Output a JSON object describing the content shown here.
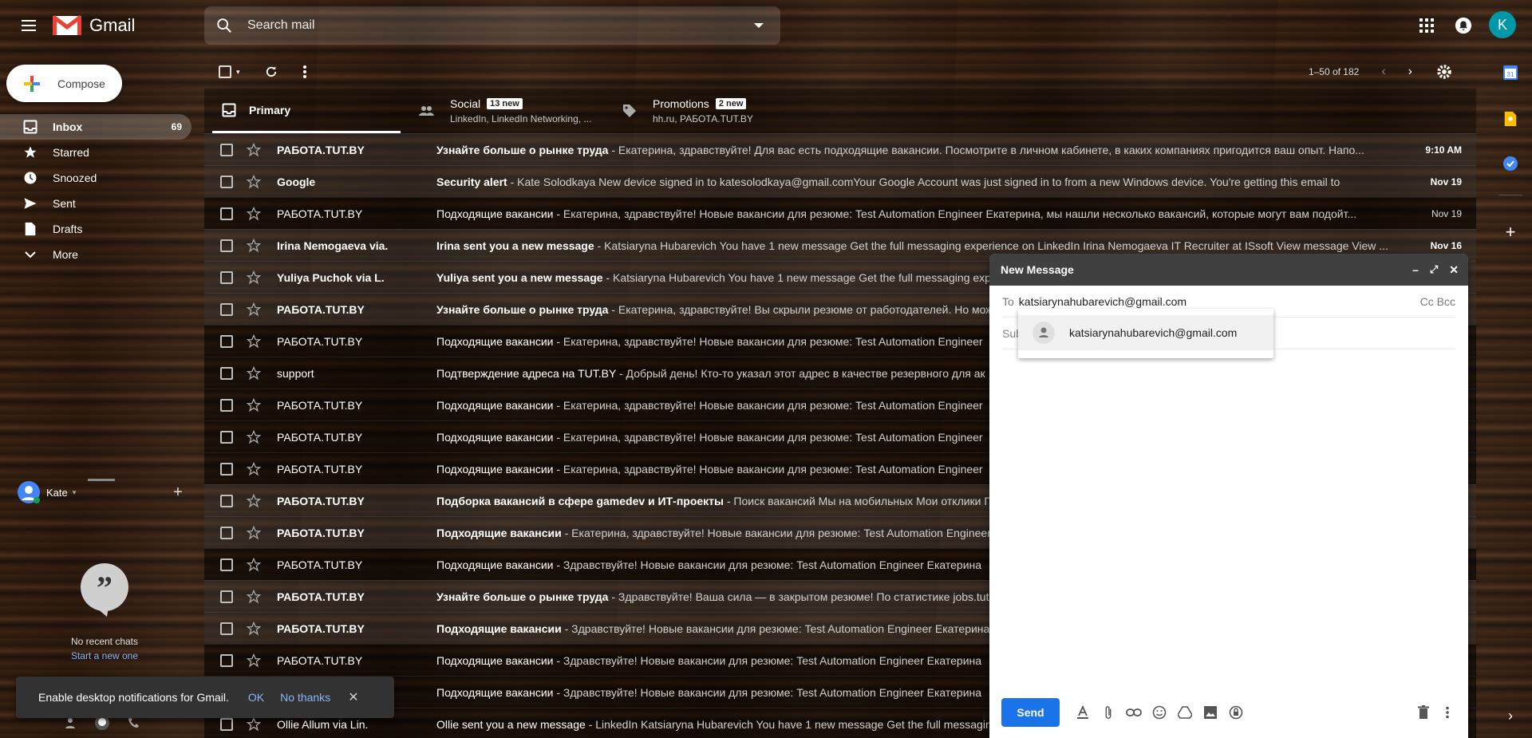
{
  "app": {
    "name": "Gmail",
    "logo_icon": "gmail-logo"
  },
  "search": {
    "placeholder": "Search mail"
  },
  "account": {
    "initial": "K",
    "color": "#0097a7"
  },
  "compose_label": "Compose",
  "nav": [
    {
      "label": "Inbox",
      "count": "69",
      "icon": "inbox-icon",
      "active": true
    },
    {
      "label": "Starred",
      "count": "",
      "icon": "star-icon"
    },
    {
      "label": "Snoozed",
      "count": "",
      "icon": "clock-icon"
    },
    {
      "label": "Sent",
      "count": "",
      "icon": "send-icon"
    },
    {
      "label": "Drafts",
      "count": "",
      "icon": "draft-icon"
    },
    {
      "label": "More",
      "count": "",
      "icon": "chevron-down-icon"
    }
  ],
  "hangouts": {
    "user": "Kate",
    "no_chats": "No recent chats",
    "start_new": "Start a new one"
  },
  "toolbar": {
    "pagination": "1–50 of 182"
  },
  "tabs": [
    {
      "label": "Primary",
      "sub": "",
      "badge": "",
      "icon": "inbox-icon",
      "active": true
    },
    {
      "label": "Social",
      "sub": "LinkedIn, LinkedIn Networking, ...",
      "badge": "13 new",
      "icon": "people-icon"
    },
    {
      "label": "Promotions",
      "sub": "hh.ru, РАБОТА.TUT.BY",
      "badge": "2 new",
      "icon": "tag-icon"
    }
  ],
  "emails": [
    {
      "sender": "РАБОТА.TUT.BY",
      "subject": "Узнайте больше о рынке труда",
      "snippet": " - Екатерина, здравствуйте! Для вас есть подходящие вакансии. Посмотрите в личном кабинете, в каких компаниях пригодится ваш опыт. Напо...",
      "date": "9:10 AM",
      "unread": true
    },
    {
      "sender": "Google",
      "subject": "Security alert",
      "snippet": " - Kate Solodkaya New device signed in to katesolodkaya@gmail.comYour Google Account was just signed in to from a new Windows device. You're getting this email to",
      "date": "Nov 19",
      "unread": true
    },
    {
      "sender": "РАБОТА.TUT.BY",
      "subject": "Подходящие вакансии",
      "snippet": " - Екатерина, здравствуйте! Новые вакансии для резюме: Test Automation Engineer Екатерина, мы нашли несколько вакансий, которые могут вам подойт...",
      "date": "Nov 19",
      "unread": false
    },
    {
      "sender": "Irina Nemogaeva via.",
      "subject": "Irina sent you a new message",
      "snippet": " - Katsiaryna Hubarevich You have 1 new message Get the full messaging experience on LinkedIn Irina Nemogaeva IT Recruiter at ISsoft View message View ...",
      "date": "Nov 16",
      "unread": true
    },
    {
      "sender": "Yuliya Puchok via L.",
      "subject": "Yuliya sent you a new message",
      "snippet": " - Katsiaryna Hubarevich You have 1 new message Get the full messaging experience",
      "date": "",
      "unread": true
    },
    {
      "sender": "РАБОТА.TUT.BY",
      "subject": "Узнайте больше о рынке труда",
      "snippet": " - Екатерина, здравствуйте! Вы скрыли резюме от работодателей. Но может",
      "date": "",
      "unread": true
    },
    {
      "sender": "РАБОТА.TUT.BY",
      "subject": "Подходящие вакансии",
      "snippet": " - Екатерина, здравствуйте! Новые вакансии для резюме: Test Automation Engineer",
      "date": "",
      "unread": false
    },
    {
      "sender": "support",
      "subject": "Подтверждение адреса на TUT.BY",
      "snippet": " - Добрый день! Кто-то указал этот адрес в качестве резервного для ак",
      "date": "",
      "unread": false
    },
    {
      "sender": "РАБОТА.TUT.BY",
      "subject": "Подходящие вакансии",
      "snippet": " - Екатерина, здравствуйте! Новые вакансии для резюме: Test Automation Engineer",
      "date": "",
      "unread": false
    },
    {
      "sender": "РАБОТА.TUT.BY",
      "subject": "Подходящие вакансии",
      "snippet": " - Екатерина, здравствуйте! Новые вакансии для резюме: Test Automation Engineer",
      "date": "",
      "unread": false
    },
    {
      "sender": "РАБОТА.TUT.BY",
      "subject": "Подходящие вакансии",
      "snippet": " - Екатерина, здравствуйте! Новые вакансии для резюме: Test Automation Engineer",
      "date": "",
      "unread": false
    },
    {
      "sender": "РАБОТА.TUT.BY",
      "subject": "Подборка вакансий в сфере gamedev и ИТ-проекты",
      "snippet": " - Поиск вакансий Мы на мобильных Мои отклики П",
      "date": "",
      "unread": true
    },
    {
      "sender": "РАБОТА.TUT.BY",
      "subject": "Подходящие вакансии",
      "snippet": " - Екатерина, здравствуйте! Новые вакансии для резюме: Test Automation Engineer",
      "date": "",
      "unread": true
    },
    {
      "sender": "РАБОТА.TUT.BY",
      "subject": "Подходящие вакансии",
      "snippet": " - Здравствуйте! Новые вакансии для резюме: Test Automation Engineer Екатерина",
      "date": "",
      "unread": false
    },
    {
      "sender": "РАБОТА.TUT.BY",
      "subject": "Узнайте больше о рынке труда",
      "snippet": " - Здравствуйте! Ваша сила — в закрытом резюме! По статистике jobs.tut",
      "date": "",
      "unread": true
    },
    {
      "sender": "РАБОТА.TUT.BY",
      "subject": "Подходящие вакансии",
      "snippet": " - Здравствуйте! Новые вакансии для резюме: Test Automation Engineer Екатерина",
      "date": "",
      "unread": true
    },
    {
      "sender": "РАБОТА.TUT.BY",
      "subject": "Подходящие вакансии",
      "snippet": " - Здравствуйте! Новые вакансии для резюме: Test Automation Engineer Екатерина",
      "date": "",
      "unread": false
    },
    {
      "sender": "РАБОТА.TUT.BY",
      "subject": "Подходящие вакансии",
      "snippet": " - Здравствуйте! Новые вакансии для резюме: Test Automation Engineer Екатерина",
      "date": "",
      "unread": false
    },
    {
      "sender": "Ollie Allum via Lin.",
      "subject": "Ollie sent you a new message",
      "snippet": " - LinkedIn Katsiaryna Hubarevich You have 1 new message Get the full messaging",
      "date": "",
      "unread": false
    }
  ],
  "composer": {
    "title": "New Message",
    "to_label": "To",
    "to_value": "katsiarynahubarevich@gmail.com",
    "cc_bcc": "Cc Bcc",
    "subject_placeholder": "Sub",
    "suggestion": "katsiarynahubarevich@gmail.com",
    "send_label": "Send"
  },
  "toast": {
    "message": "Enable desktop notifications for Gmail.",
    "ok": "OK",
    "no": "No thanks"
  },
  "colors": {
    "accent": "#1a73e8",
    "gmail_red": "#ea4335"
  }
}
